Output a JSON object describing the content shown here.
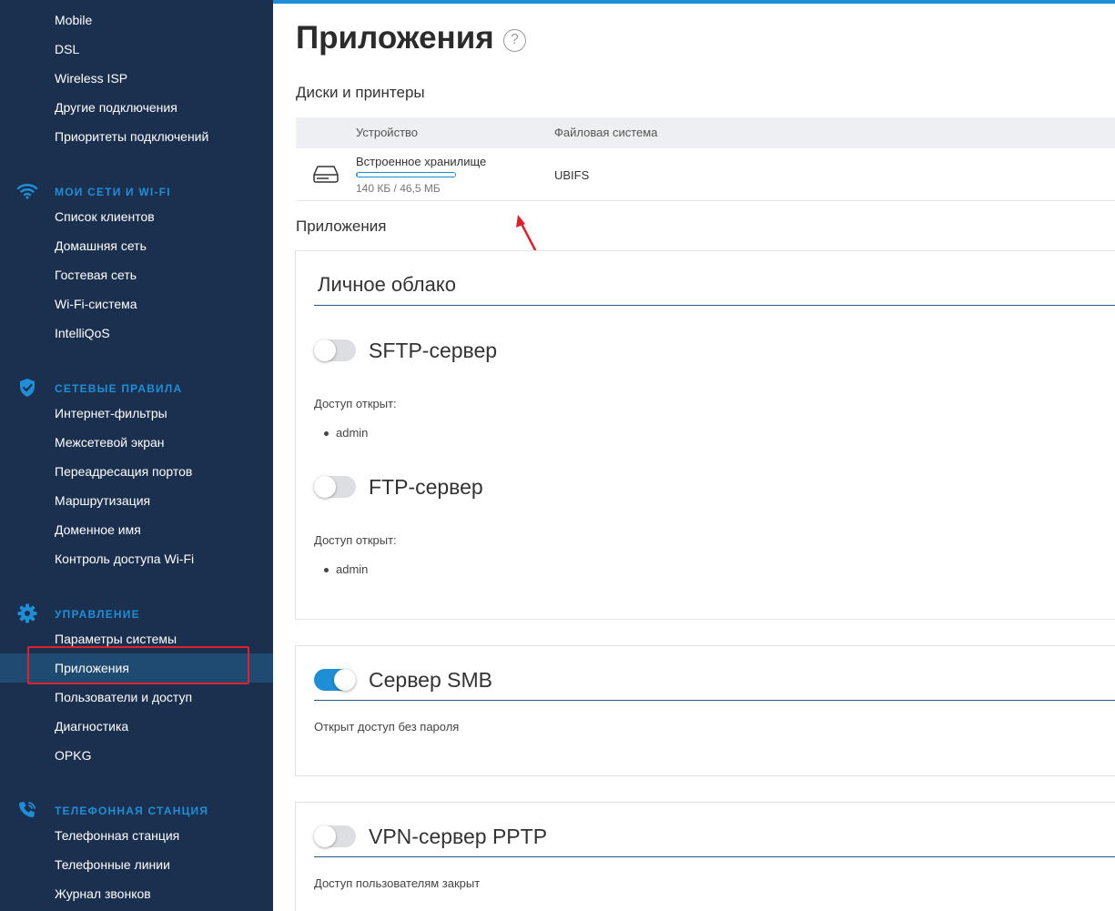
{
  "sidebar": {
    "top_items": [
      "Mobile",
      "DSL",
      "Wireless ISP",
      "Другие подключения",
      "Приоритеты подключений"
    ],
    "sections": [
      {
        "title": "МОИ СЕТИ И WI-FI",
        "icon": "wifi-icon",
        "items": [
          "Список клиентов",
          "Домашняя сеть",
          "Гостевая сеть",
          "Wi-Fi-система",
          "IntelliQoS"
        ]
      },
      {
        "title": "СЕТЕВЫЕ ПРАВИЛА",
        "icon": "shield-icon",
        "items": [
          "Интернет-фильтры",
          "Межсетевой экран",
          "Переадресация портов",
          "Маршрутизация",
          "Доменное имя",
          "Контроль доступа Wi-Fi"
        ]
      },
      {
        "title": "УПРАВЛЕНИЕ",
        "icon": "gear-icon",
        "items": [
          "Параметры системы",
          "Приложения",
          "Пользователи и доступ",
          "Диагностика",
          "OPKG"
        ]
      },
      {
        "title": "ТЕЛЕФОННАЯ СТАНЦИЯ",
        "icon": "phone-icon",
        "items": [
          "Телефонная станция",
          "Телефонные линии",
          "Журнал звонков"
        ]
      }
    ],
    "active_item": "Приложения"
  },
  "page": {
    "title": "Приложения",
    "help_symbol": "?"
  },
  "disks": {
    "heading": "Диски и принтеры",
    "columns": [
      "Устройство",
      "Файловая система"
    ],
    "rows": [
      {
        "name": "Встроенное хранилище",
        "usage": "140 КБ / 46,5 МБ",
        "usage_fraction": 0.003,
        "filesystem": "UBIFS"
      }
    ]
  },
  "apps": {
    "heading": "Приложения",
    "cloud": {
      "title": "Личное облако",
      "services": [
        {
          "name": "SFTP-сервер",
          "enabled": false,
          "access_label": "Доступ открыт:",
          "users": [
            "admin"
          ]
        },
        {
          "name": "FTP-сервер",
          "enabled": false,
          "access_label": "Доступ открыт:",
          "users": [
            "admin"
          ]
        }
      ]
    },
    "smb": {
      "name": "Сервер SMB",
      "enabled": true,
      "note": "Открыт доступ без пароля"
    },
    "pptp": {
      "name": "VPN-сервер PPTP",
      "enabled": false,
      "note": "Доступ пользователям закрыт"
    }
  },
  "colors": {
    "sidebar_bg": "#1b2f4f",
    "accent": "#1e8fd6",
    "annotation_red": "#e0202a"
  }
}
